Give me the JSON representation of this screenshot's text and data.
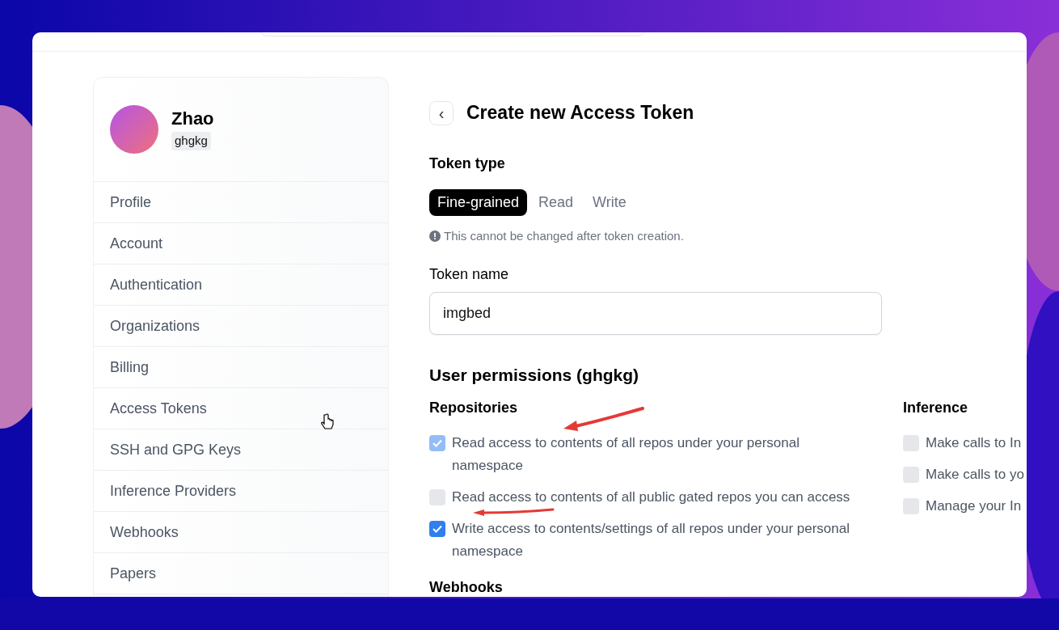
{
  "top_bar": {
    "search": {
      "kind": "field"
    }
  },
  "sidebar": {
    "user": {
      "name": "Zhao",
      "username": "ghgkg"
    },
    "items": [
      {
        "label": "Profile",
        "selected": false
      },
      {
        "label": "Account",
        "selected": false
      },
      {
        "label": "Authentication",
        "selected": false
      },
      {
        "label": "Organizations",
        "selected": false
      },
      {
        "label": "Billing",
        "selected": false
      },
      {
        "label": "Access Tokens",
        "selected": false
      },
      {
        "label": "SSH and GPG Keys",
        "selected": false
      },
      {
        "label": "Inference Providers",
        "selected": false
      },
      {
        "label": "Webhooks",
        "selected": false
      },
      {
        "label": "Papers",
        "selected": false
      }
    ]
  },
  "main": {
    "title": "Create new Access Token",
    "back": "‹",
    "token_type": {
      "label": "Token type",
      "options": [
        {
          "label": "Fine-grained",
          "selected": true
        },
        {
          "label": "Read",
          "selected": false
        },
        {
          "label": "Write",
          "selected": false
        }
      ],
      "note": "This cannot be changed after token creation."
    },
    "token_name": {
      "label": "Token name",
      "value": "imgbed"
    },
    "permissions": {
      "title": "User permissions (ghgkg)",
      "groups": [
        {
          "title": "Repositories",
          "items": [
            {
              "label": "Read access to contents of all repos under your personal namespace",
              "checked": true,
              "disabled": true
            },
            {
              "label": "Read access to contents of all public gated repos you can access",
              "checked": false,
              "disabled": false
            },
            {
              "label": "Write access to contents/settings of all repos under your personal namespace",
              "checked": true,
              "disabled": false
            }
          ]
        },
        {
          "title": "Inference",
          "items": [
            {
              "label": "Make calls to In",
              "checked": false,
              "disabled": false
            },
            {
              "label": "Make calls to yo",
              "checked": false,
              "disabled": false
            },
            {
              "label": "Manage your In",
              "checked": false,
              "disabled": false
            }
          ]
        }
      ]
    },
    "next_section": "Webhooks"
  }
}
